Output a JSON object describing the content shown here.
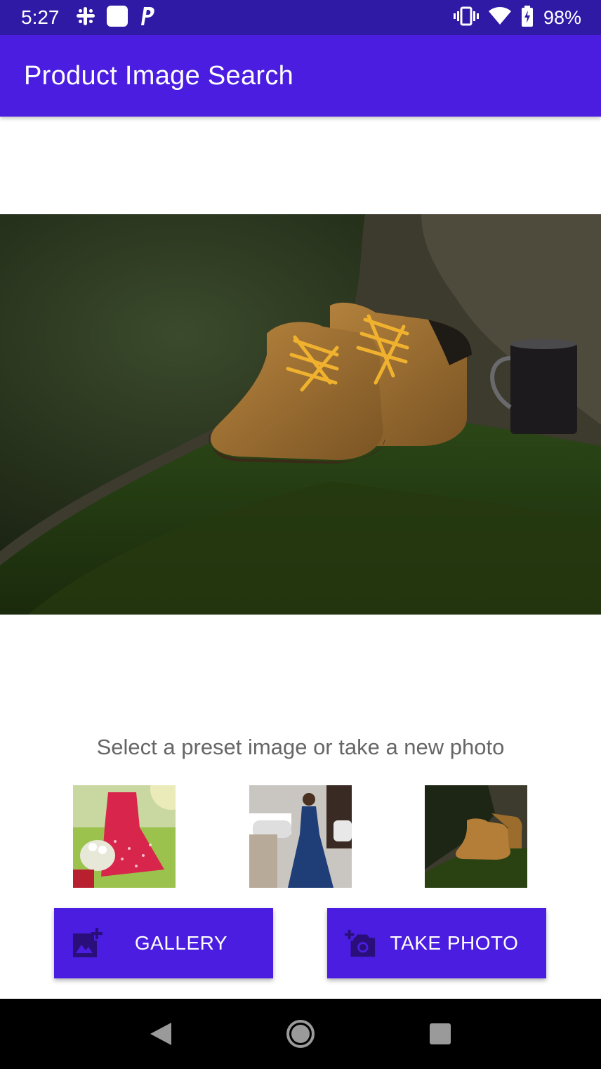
{
  "status_bar": {
    "time": "5:27",
    "battery": "98%",
    "left_icons": [
      "slack-icon",
      "app-square-icon",
      "paypal-icon"
    ],
    "right_icons": [
      "vibrate-icon",
      "wifi-icon",
      "battery-charging-icon"
    ]
  },
  "app_bar": {
    "title": "Product Image Search",
    "color": "#4a1de0"
  },
  "preview": {
    "alt": "boots-on-mossy-tree"
  },
  "prompt": "Select a preset image or take a new photo",
  "presets": [
    {
      "name": "preset-red-dress"
    },
    {
      "name": "preset-blue-gown"
    },
    {
      "name": "preset-boots"
    }
  ],
  "buttons": {
    "gallery": {
      "label": "GALLERY",
      "icon": "add-photo-icon"
    },
    "take_photo": {
      "label": "TAKE PHOTO",
      "icon": "add-camera-icon"
    }
  },
  "nav_bar": {
    "icons": [
      "back-icon",
      "home-icon",
      "recents-icon"
    ]
  },
  "colors": {
    "status_bar": "#2f1aa5",
    "primary": "#4a1de0",
    "text_secondary": "#666666"
  }
}
